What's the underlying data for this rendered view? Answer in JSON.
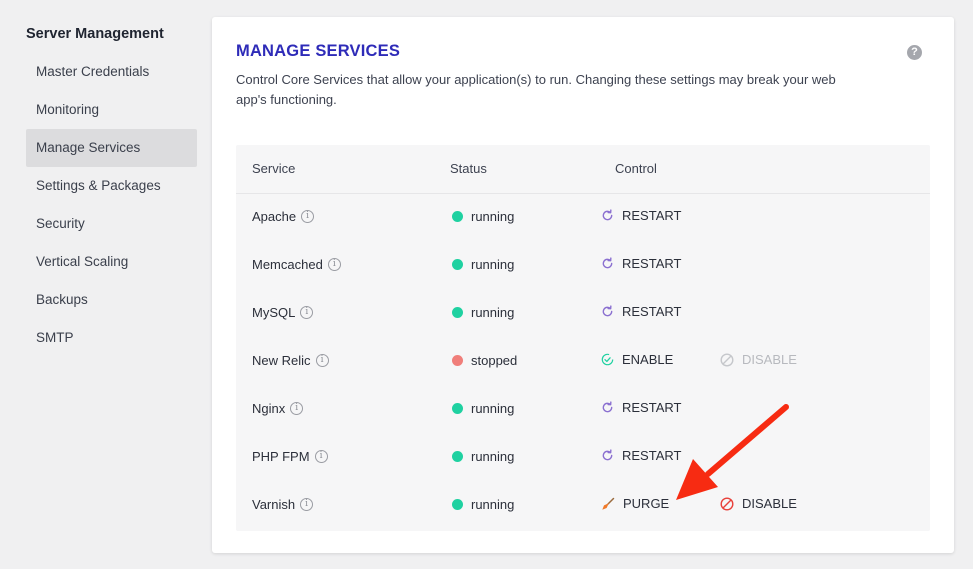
{
  "sidebar": {
    "title": "Server Management",
    "items": [
      {
        "label": "Master Credentials",
        "active": false
      },
      {
        "label": "Monitoring",
        "active": false
      },
      {
        "label": "Manage Services",
        "active": true
      },
      {
        "label": "Settings & Packages",
        "active": false
      },
      {
        "label": "Security",
        "active": false
      },
      {
        "label": "Vertical Scaling",
        "active": false
      },
      {
        "label": "Backups",
        "active": false
      },
      {
        "label": "SMTP",
        "active": false
      }
    ]
  },
  "panel": {
    "title": "MANAGE SERVICES",
    "description": "Control Core Services that allow your application(s) to run. Changing these settings may break your web app's functioning.",
    "help_icon": "?",
    "info_glyph": "i"
  },
  "table": {
    "headers": {
      "service": "Service",
      "status": "Status",
      "control": "Control"
    },
    "rows": [
      {
        "service": "Apache",
        "status": "running",
        "status_color": "#1fd1a1",
        "actions": [
          {
            "label": "RESTART",
            "icon": "restart-icon",
            "disabled": false
          }
        ]
      },
      {
        "service": "Memcached",
        "status": "running",
        "status_color": "#1fd1a1",
        "actions": [
          {
            "label": "RESTART",
            "icon": "restart-icon",
            "disabled": false
          }
        ]
      },
      {
        "service": "MySQL",
        "status": "running",
        "status_color": "#1fd1a1",
        "actions": [
          {
            "label": "RESTART",
            "icon": "restart-icon",
            "disabled": false
          }
        ]
      },
      {
        "service": "New Relic",
        "status": "stopped",
        "status_color": "#f07e7a",
        "actions": [
          {
            "label": "ENABLE",
            "icon": "check-circle-icon",
            "disabled": false
          },
          {
            "label": "DISABLE",
            "icon": "ban-icon",
            "disabled": true
          }
        ]
      },
      {
        "service": "Nginx",
        "status": "running",
        "status_color": "#1fd1a1",
        "actions": [
          {
            "label": "RESTART",
            "icon": "restart-icon",
            "disabled": false
          }
        ]
      },
      {
        "service": "PHP FPM",
        "status": "running",
        "status_color": "#1fd1a1",
        "actions": [
          {
            "label": "RESTART",
            "icon": "restart-icon",
            "disabled": false
          }
        ]
      },
      {
        "service": "Varnish",
        "status": "running",
        "status_color": "#1fd1a1",
        "actions": [
          {
            "label": "PURGE",
            "icon": "broom-icon",
            "disabled": false
          },
          {
            "label": "DISABLE",
            "icon": "ban-icon",
            "disabled": false
          }
        ]
      }
    ]
  },
  "colors": {
    "accent": "#2e2bb8",
    "restart_icon": "#8a6fd0",
    "enable_icon": "#1fd1a1",
    "disable_icon": "#e8403a",
    "disabled_icon": "#c5c7cb",
    "broom_icon": "#f07a2a",
    "annotation_arrow": "#f72b12"
  }
}
